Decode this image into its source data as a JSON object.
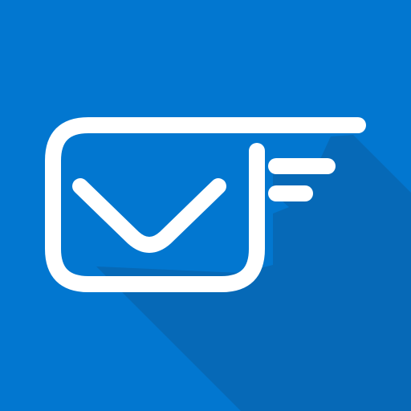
{
  "icon": {
    "name": "mail-app-icon",
    "glyph": "envelope-with-speed-lines-icon",
    "colors": {
      "background": "#0277d0",
      "long_shadow": "#0669b7",
      "glyph": "#ffffff"
    }
  }
}
